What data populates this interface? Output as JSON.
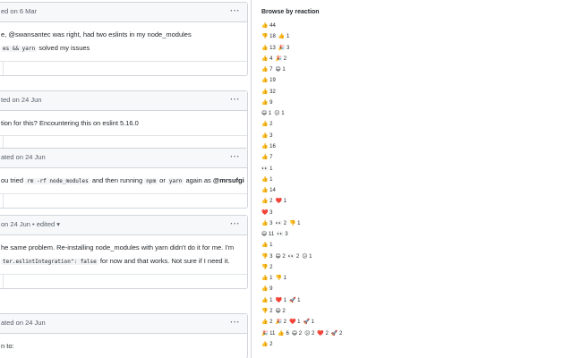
{
  "comments": [
    {
      "header": "ed on 6 Mar",
      "body_lines": [
        [
          {
            "t": "text",
            "v": "e, @swansantec was right, had two eslints in my node_modules"
          }
        ],
        [
          {
            "t": "code",
            "v": "es && yarn"
          },
          {
            "t": "text",
            "v": " solved my issues"
          }
        ]
      ],
      "has_footer": true
    },
    {
      "header": "ted on 24 Jun",
      "body_lines": [
        [
          {
            "t": "text",
            "v": "tion for this? Encountering this on eslint 5.16.0"
          }
        ]
      ],
      "has_footer": true
    },
    {
      "header": "ated on 24 Jun",
      "body_lines": [
        [
          {
            "t": "text",
            "v": "ou tried "
          },
          {
            "t": "code",
            "v": "rm -rf node_modules"
          },
          {
            "t": "text",
            "v": " and then running "
          },
          {
            "t": "code",
            "v": "npm"
          },
          {
            "t": "text",
            "v": " or "
          },
          {
            "t": "code",
            "v": "yarn"
          },
          {
            "t": "text",
            "v": " again as "
          },
          {
            "t": "mention",
            "v": "@mrsufgi"
          }
        ]
      ],
      "has_footer": true
    },
    {
      "header": "on 24 Jun • edited ▾",
      "body_lines": [
        [
          {
            "t": "text",
            "v": "he same problem. Re-installing node_modules with yarn didn't do it for me. I'm"
          }
        ],
        [
          {
            "t": "code",
            "v": "ter.eslintIntegration\": false"
          },
          {
            "t": "text",
            "v": " for now and that works. Not sure if I need it."
          }
        ]
      ],
      "has_footer": true
    },
    {
      "header": "ated on 24 Jun",
      "body_lines": [
        [
          {
            "t": "text",
            "v": "n to:"
          }
        ]
      ],
      "has_footer": false
    }
  ],
  "more_options_icon": "⋯",
  "browse": {
    "title": "Browse by reaction",
    "rows": [
      [
        "👍 44"
      ],
      [
        "👎 18",
        "👍 1"
      ],
      [
        "👍 13",
        "🎉 3"
      ],
      [
        "👍 4",
        "🎉 2"
      ],
      [
        "👍 7",
        "😄 1"
      ],
      [
        "👍 19"
      ],
      [
        "👍 32"
      ],
      [
        "👍 9"
      ],
      [
        "😄 1",
        "😕 1"
      ],
      [
        "👍 2"
      ],
      [
        "👍 3"
      ],
      [
        "👍 16"
      ],
      [
        "👍 7"
      ],
      [
        "👀 1"
      ],
      [
        "👍 1"
      ],
      [
        "👍 14"
      ],
      [
        "👍 2",
        "❤️ 1"
      ],
      [
        "❤️ 3"
      ],
      [
        "👍 3",
        "👀 2",
        "👎 1"
      ],
      [
        "😄 11",
        "👀 3"
      ],
      [
        "👍 1"
      ],
      [
        "👎 3",
        "😄 2",
        "👀 2",
        "😕 1"
      ],
      [
        "👎 2"
      ],
      [
        "👍 1",
        "👎 1"
      ],
      [
        "👍 9"
      ],
      [
        "👍 1",
        "❤️ 1",
        "🚀 1"
      ],
      [
        "👎 2",
        "😄 2"
      ],
      [
        "👍 2",
        "🎉 2",
        "❤️ 1",
        "🚀 1"
      ],
      [
        "🎉 11",
        "👍 6",
        "😄 2",
        "😕 2",
        "❤️ 2",
        "🚀 2"
      ],
      [
        "👍 2"
      ]
    ]
  }
}
